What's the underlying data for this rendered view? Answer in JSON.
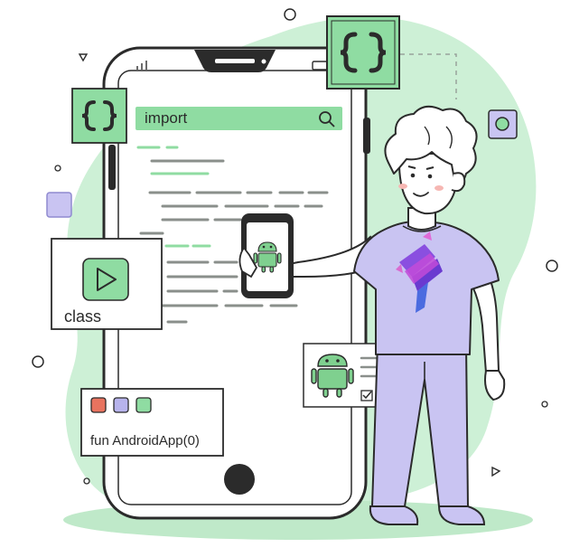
{
  "search": {
    "query": "import",
    "icon": "search-icon"
  },
  "class_card": {
    "label": "class",
    "icon": "play-icon"
  },
  "code_card": {
    "code": "fun AndroidApp(0)",
    "dots": [
      "#e8735f",
      "#b7b3ec",
      "#8fdca2"
    ]
  },
  "badges": {
    "icon": "curly-braces-icon"
  },
  "colors": {
    "mint_background": "#cdf0d6",
    "accent_green": "#8fdca2",
    "lavender": "#c9c4f2",
    "outline": "#2b2b2b",
    "android_green": "#7fd08f"
  }
}
